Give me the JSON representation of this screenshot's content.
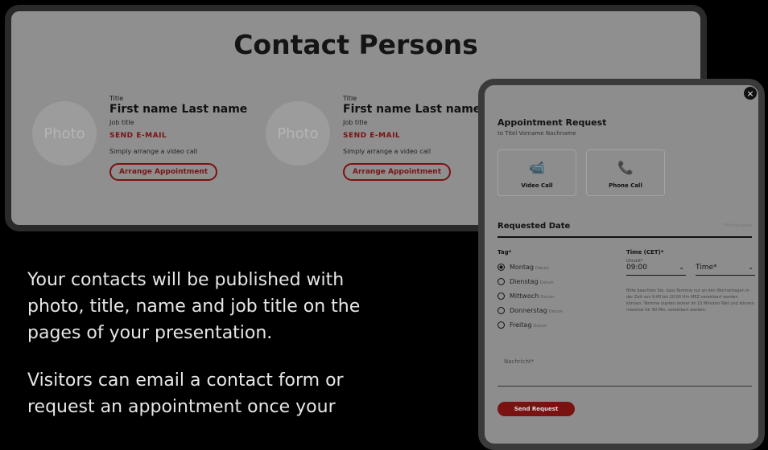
{
  "contact_page": {
    "title": "Contact Persons",
    "cards": [
      {
        "photo_label": "Photo",
        "title_label": "Title",
        "name": "First name Last name",
        "job_title": "Job title",
        "email_link": "SEND E-MAIL",
        "video_text": "Simply arrange a video call",
        "appointment_button": "Arrange Appointment"
      },
      {
        "photo_label": "Photo",
        "title_label": "Title",
        "name": "First name Last name",
        "job_title": "Job title",
        "email_link": "SEND E-MAIL",
        "video_text": "Simply arrange a video call",
        "appointment_button": "Arrange Appointment"
      }
    ]
  },
  "appointment_form": {
    "close_icon": "×",
    "title": "Appointment Request",
    "subtitle": "to Titel Vorname Nachname",
    "options": [
      {
        "icon": "video-call-icon",
        "glyph": "📹",
        "label": "Video Call"
      },
      {
        "icon": "phone-icon",
        "glyph": "📞",
        "label": "Phone Call"
      }
    ],
    "requested_date": "Requested Date",
    "required_note": "*Pflichtangabe",
    "day_label": "Tag*",
    "days": [
      {
        "name": "Montag",
        "date": "Datum",
        "selected": true
      },
      {
        "name": "Dienstag",
        "date": "Datum",
        "selected": false
      },
      {
        "name": "Mittwoch",
        "date": "Datum",
        "selected": false
      },
      {
        "name": "Donnerstag",
        "date": "Datum",
        "selected": false
      },
      {
        "name": "Freitag",
        "date": "Datum",
        "selected": false
      }
    ],
    "time_label": "Time (CET)*",
    "time_from_small": "Uhrzeit*",
    "time_from": "09:00",
    "time_to": "Time*",
    "time_note": "Bitte beachten Sie, dass Termine nur an den Wochentagen in der Zeit von 9:00 bis 20:00 Uhr MEZ vereinbart werden können. Termine starten immer im 15 Minuten-Takt und können maximal für 90 Min. vereinbart werden.",
    "message_placeholder": "Nachricht*",
    "send_button": "Send Request"
  },
  "description": {
    "p1": "Your contacts will be published with photo, title, name and job title on the pages of your presentation.",
    "p2": "Visitors can email a contact form or request an appointment once your"
  }
}
